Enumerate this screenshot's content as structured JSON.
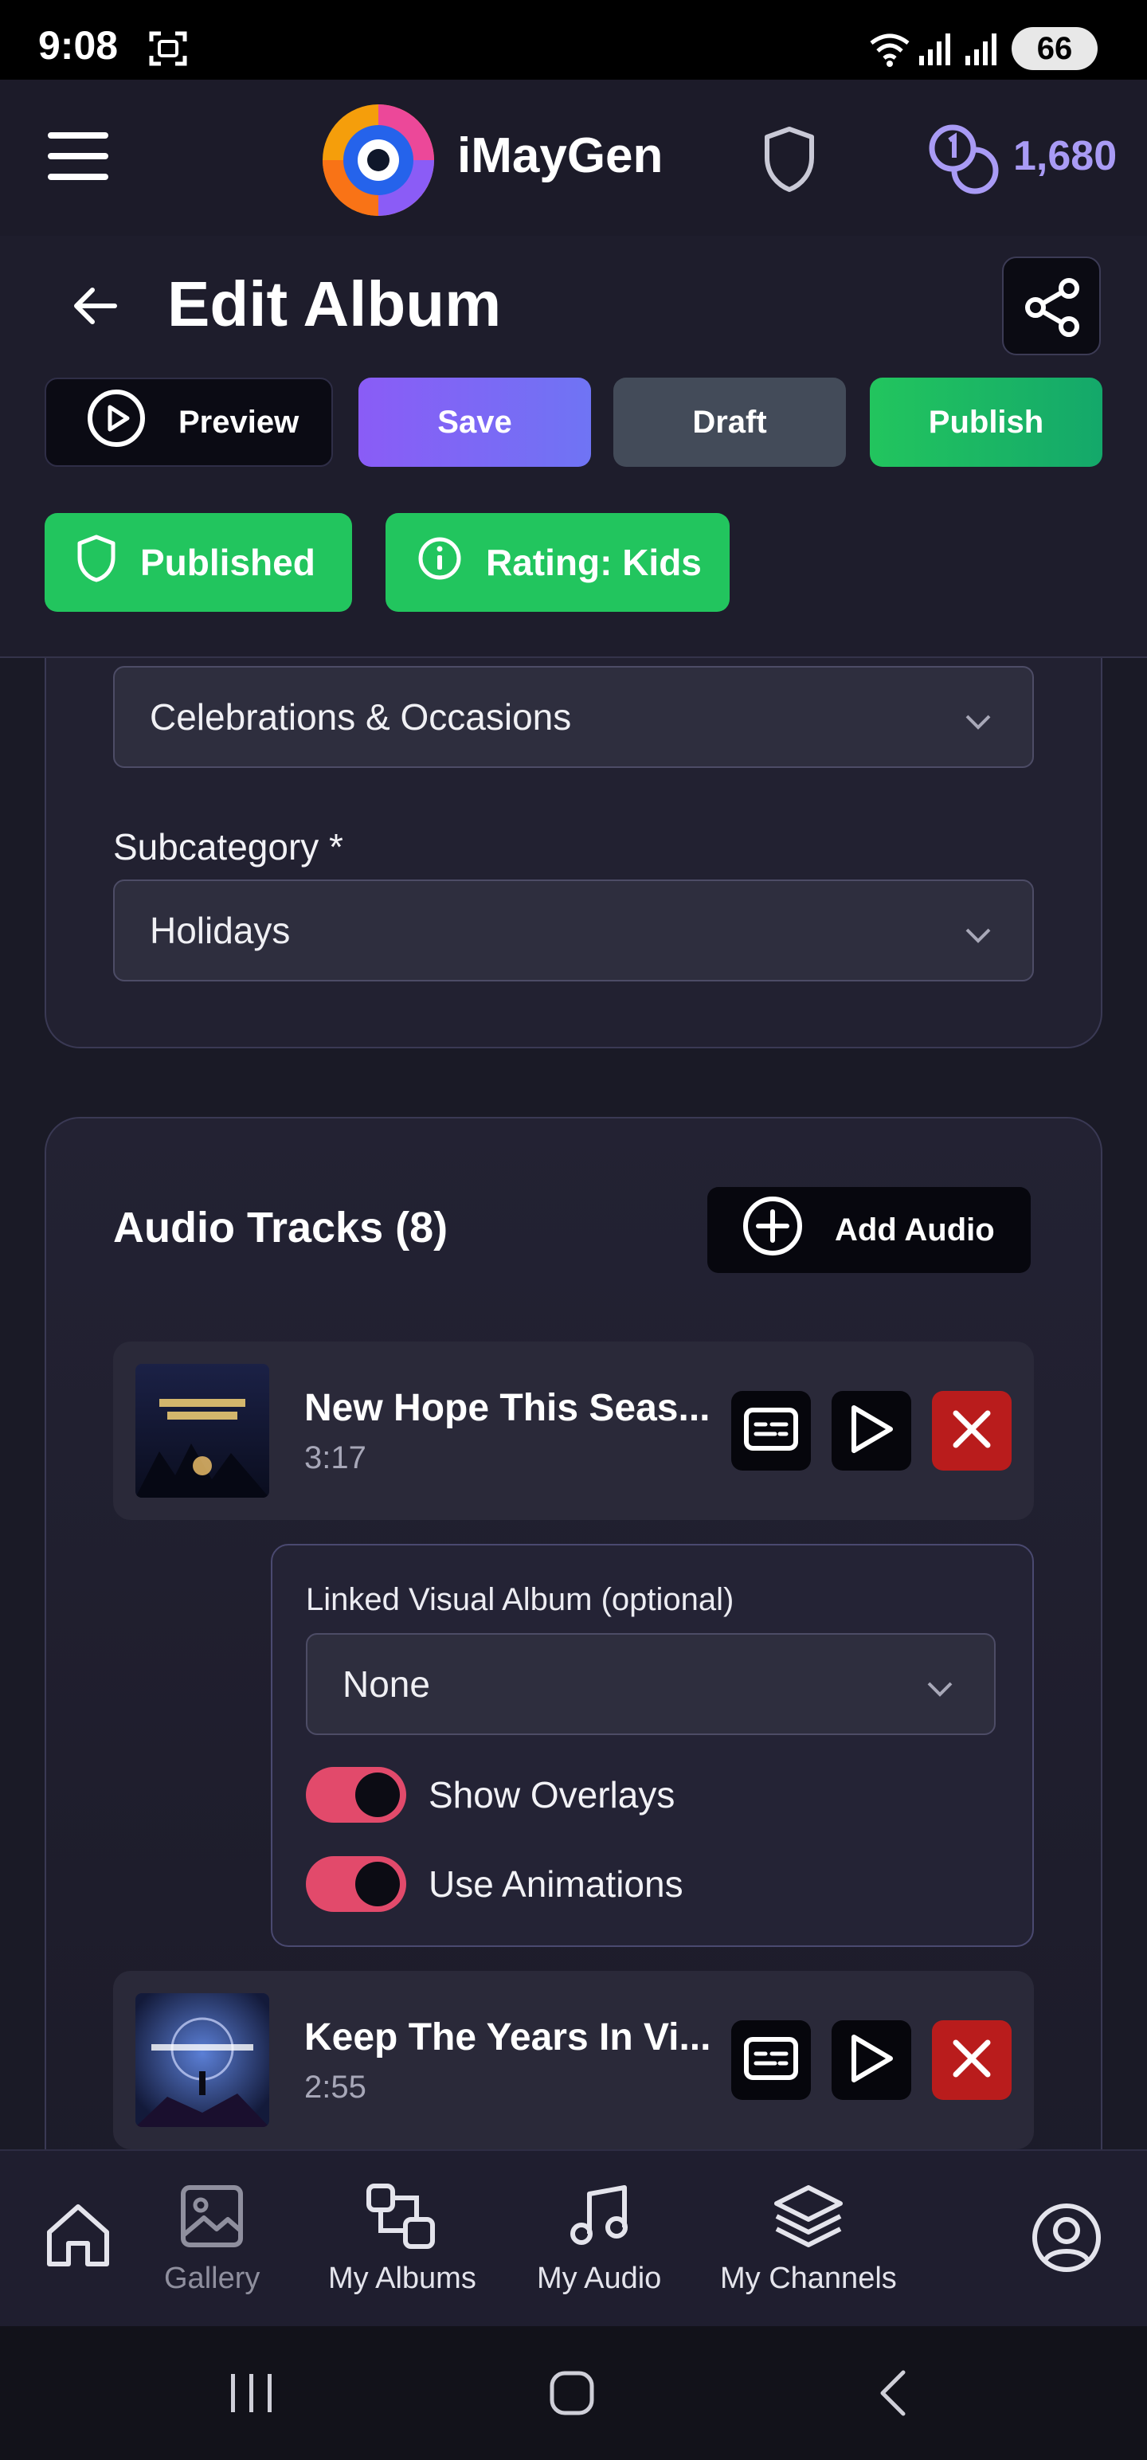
{
  "status_bar": {
    "time": "9:08",
    "battery": "66"
  },
  "header": {
    "brand": "iMayGen",
    "credits": "1,680"
  },
  "page": {
    "title": "Edit Album"
  },
  "actions": {
    "preview": "Preview",
    "save": "Save",
    "draft": "Draft",
    "publish": "Publish"
  },
  "badges": {
    "published": "Published",
    "rating": "Rating: Kids"
  },
  "categories": {
    "category_value": "Celebrations & Occasions",
    "subcategory_label": "Subcategory *",
    "subcategory_value": "Holidays"
  },
  "tracks": {
    "title": "Audio Tracks (8)",
    "add_label": "Add Audio",
    "items": [
      {
        "title": "New Hope This Seas...",
        "duration": "3:17"
      },
      {
        "title": "Keep The Years In Vi...",
        "duration": "2:55"
      }
    ],
    "linked": {
      "label": "Linked Visual Album (optional)",
      "value": "None",
      "show_overlays": "Show Overlays",
      "use_animations": "Use Animations"
    }
  },
  "nav": {
    "gallery": "Gallery",
    "my_albums": "My Albums",
    "my_audio": "My Audio",
    "my_channels": "My Channels"
  },
  "colors": {
    "accent_purple": "#8a5cf6",
    "accent_green": "#22c55e",
    "danger_red": "#b91c1c",
    "toggle_pink": "#e24a6b"
  }
}
